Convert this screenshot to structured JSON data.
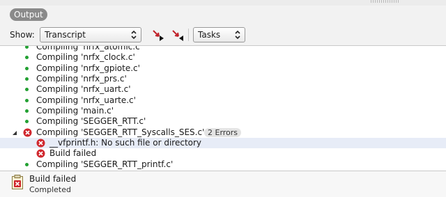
{
  "panel": {
    "title": "Output"
  },
  "toolbar": {
    "show_label": "Show:",
    "show_value": "Transcript",
    "filter_value": "Tasks"
  },
  "log": [
    {
      "text": "Compiling 'nrfx_atomic.c'",
      "status": "ok"
    },
    {
      "text": "Compiling 'nrfx_clock.c'",
      "status": "ok"
    },
    {
      "text": "Compiling 'nrfx_gpiote.c'",
      "status": "ok"
    },
    {
      "text": "Compiling 'nrfx_prs.c'",
      "status": "ok"
    },
    {
      "text": "Compiling 'nrfx_uart.c'",
      "status": "ok"
    },
    {
      "text": "Compiling 'nrfx_uarte.c'",
      "status": "ok"
    },
    {
      "text": "Compiling 'main.c'",
      "status": "ok"
    },
    {
      "text": "Compiling 'SEGGER_RTT.c'",
      "status": "ok"
    },
    {
      "text": "Compiling 'SEGGER_RTT_Syscalls_SES.c'",
      "status": "error",
      "badge": "2 Errors",
      "expanded": true
    },
    {
      "text": "__vfprintf.h: No such file or directory",
      "status": "error-child",
      "selected": true
    },
    {
      "text": "Build failed",
      "status": "error-child"
    },
    {
      "text": "Compiling 'SEGGER_RTT_printf.c'",
      "status": "ok"
    }
  ],
  "status_bar": {
    "title": "Build failed",
    "subtitle": "Completed"
  },
  "colors": {
    "ok_dot": "#22a032",
    "error_red": "#d0272e",
    "selection": "#e7ecf7"
  }
}
